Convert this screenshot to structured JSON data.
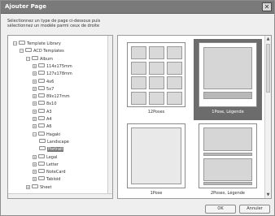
{
  "window": {
    "title": "Ajouter Page",
    "close_label": "✕"
  },
  "instructions": {
    "line1": "Sélectionnez un type de page ci-dessous puis",
    "line2": "sélectionnez un modèle parmi ceux de droite"
  },
  "tree": {
    "items": [
      {
        "label": "Template Library",
        "depth": 0,
        "expanded": true
      },
      {
        "label": "ACD Templates",
        "depth": 1,
        "expanded": true
      },
      {
        "label": "Album",
        "depth": 2,
        "expanded": true
      },
      {
        "label": "114x175mm",
        "depth": 3,
        "expanded": false
      },
      {
        "label": "127x178mm",
        "depth": 3,
        "expanded": false
      },
      {
        "label": "4x6",
        "depth": 3,
        "expanded": false
      },
      {
        "label": "5x7",
        "depth": 3,
        "expanded": false
      },
      {
        "label": "89x127mm",
        "depth": 3,
        "expanded": false
      },
      {
        "label": "8x10",
        "depth": 3,
        "expanded": false
      },
      {
        "label": "A3",
        "depth": 3,
        "expanded": false
      },
      {
        "label": "A4",
        "depth": 3,
        "expanded": false
      },
      {
        "label": "A6",
        "depth": 3,
        "expanded": false
      },
      {
        "label": "Hagaki",
        "depth": 3,
        "expanded": true
      },
      {
        "label": "Landscape",
        "depth": 4,
        "leaf": true
      },
      {
        "label": "Portrait",
        "depth": 4,
        "leaf": true,
        "selected": true
      },
      {
        "label": "Legal",
        "depth": 3,
        "expanded": false
      },
      {
        "label": "Letter",
        "depth": 3,
        "expanded": false
      },
      {
        "label": "NoteCard",
        "depth": 3,
        "expanded": false
      },
      {
        "label": "Tabloid",
        "depth": 3,
        "expanded": false
      },
      {
        "label": "Sheet",
        "depth": 2,
        "expanded": false
      }
    ]
  },
  "gallery": {
    "layouts": [
      {
        "label": "12Poses",
        "layout": "grid-3x4",
        "selected": false
      },
      {
        "label": "1Pose, Légende",
        "layout": "photo-caption",
        "selected": true
      },
      {
        "label": "1Pose",
        "layout": "single",
        "selected": false
      },
      {
        "label": "2Poses, Légende",
        "layout": "two-caption",
        "selected": false
      }
    ]
  },
  "buttons": {
    "ok": "OK",
    "cancel": "Annuler"
  }
}
